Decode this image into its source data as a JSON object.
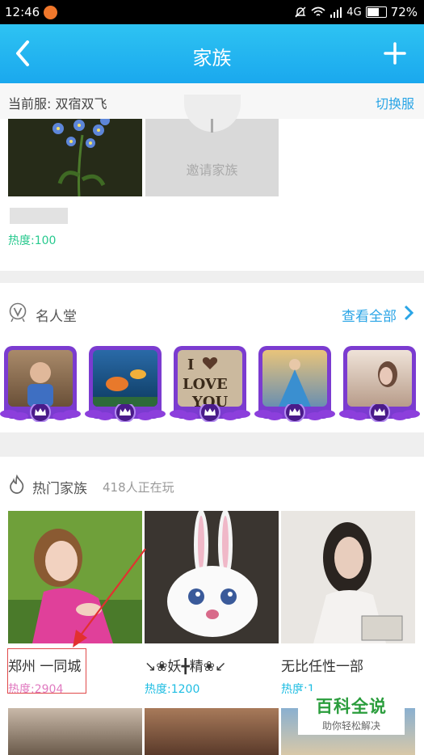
{
  "status": {
    "time": "12:46",
    "network": "4G",
    "battery": "72%",
    "battery_level": 0.72
  },
  "appbar": {
    "title": "家族"
  },
  "server": {
    "current_label": "当前服: 双宿双飞",
    "switch_label": "切换服"
  },
  "my_family": {
    "invite_label": "邀请家族",
    "heat": "热度:100"
  },
  "hall_of_fame": {
    "title": "名人堂",
    "view_all": "查看全部",
    "avatars": [
      {
        "label": "",
        "color": "#8b6a4a"
      },
      {
        "label": "",
        "color": "#3f7fb0"
      },
      {
        "label": "I ♥ LOVE YOU",
        "color": "#c9b79c"
      },
      {
        "label": "",
        "color": "#5b8fb0"
      },
      {
        "label": "",
        "color": "#d7c3b4"
      }
    ]
  },
  "hot_families": {
    "title": "热门家族",
    "subtitle": "418人正在玩",
    "cards": [
      {
        "name": "郑州 一同城",
        "heat": "热度:2904",
        "heat_color": "#e07ac0"
      },
      {
        "name": "↘❀妖╋精❀↙",
        "heat": "热度:1200",
        "heat_color": "#1fbde2"
      },
      {
        "name": "无比任性一部",
        "heat": "热度:1",
        "heat_color": "#1fbde2"
      }
    ]
  },
  "watermark": {
    "title": "百科全说",
    "subtitle": "助你轻松解决"
  },
  "colors": {
    "accent": "#2aa5e6",
    "header": "#1aa8ee",
    "heat_green": "#27c98e",
    "avatar_purple": "#7b3bd0"
  }
}
